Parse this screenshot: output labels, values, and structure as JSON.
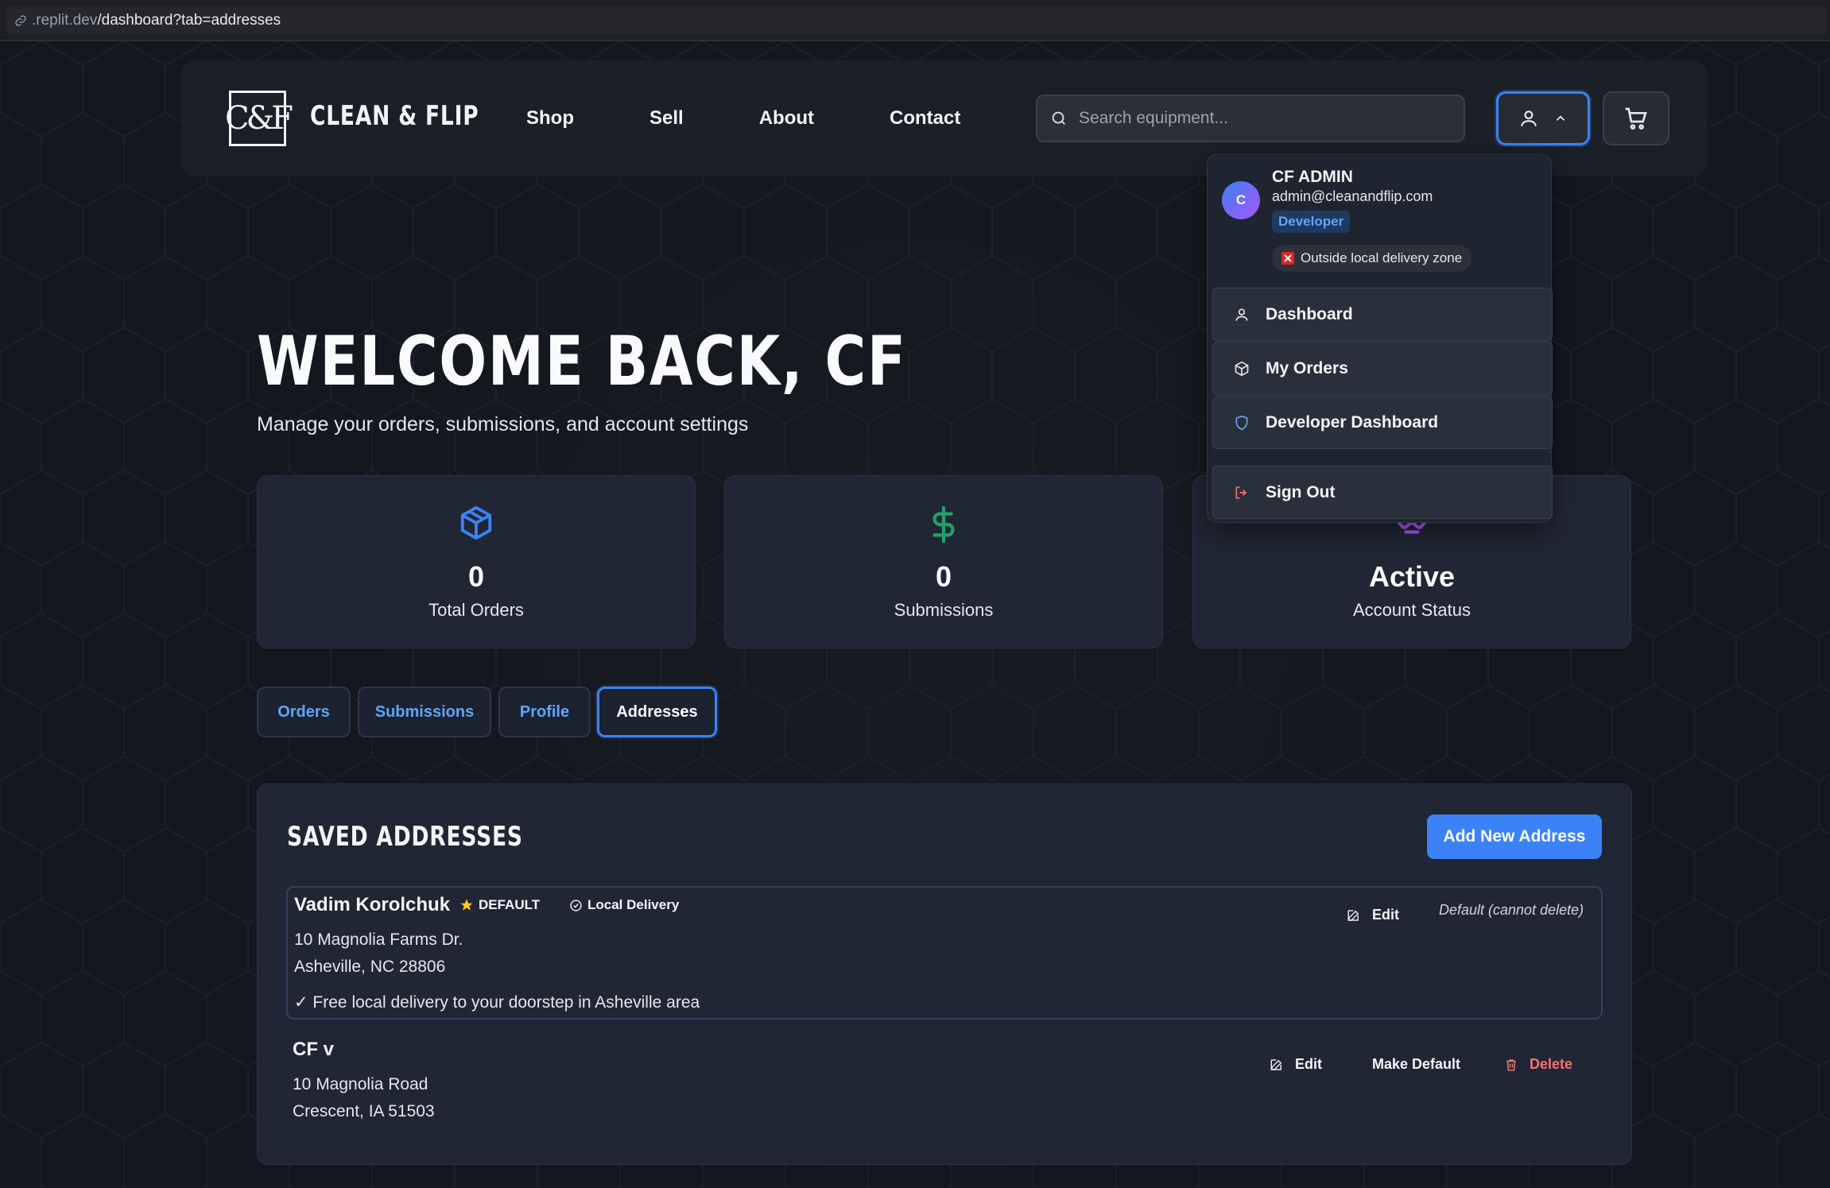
{
  "browser": {
    "url_domain": ".replit.dev",
    "url_path": "/dashboard?tab=addresses"
  },
  "header": {
    "logo_text": "C&F",
    "brand": "CLEAN & FLIP",
    "nav": [
      "Shop",
      "Sell",
      "About",
      "Contact"
    ],
    "search_placeholder": "Search equipment..."
  },
  "welcome": {
    "title": "WELCOME BACK, CF",
    "subtitle": "Manage your orders, submissions, and account settings"
  },
  "stats": [
    {
      "value": "0",
      "label": "Total Orders",
      "icon": "package-icon",
      "color": "#3b82f6"
    },
    {
      "value": "0",
      "label": "Submissions",
      "icon": "dollar-icon",
      "color": "#22a06b"
    },
    {
      "value": "Active",
      "label": "Account Status",
      "icon": "account-status-icon",
      "color": "#a855f7"
    }
  ],
  "tabs": [
    "Orders",
    "Submissions",
    "Profile",
    "Addresses"
  ],
  "active_tab": "Addresses",
  "addresses_panel": {
    "title": "SAVED ADDRESSES",
    "add_button": "Add New Address",
    "addresses": [
      {
        "name": "Vadim Korolchuk",
        "default_badge": "DEFAULT",
        "local_badge": "Local Delivery",
        "line1": "10 Magnolia Farms Dr.",
        "line2": "Asheville, NC 28806",
        "delivery_note": "✓ Free local delivery to your doorstep in Asheville area",
        "edit_label": "Edit",
        "default_note": "Default (cannot delete)"
      },
      {
        "name": "CF v",
        "line1": "10 Magnolia Road",
        "line2": "Crescent, IA 51503",
        "edit_label": "Edit",
        "make_default_label": "Make Default",
        "delete_label": "Delete"
      }
    ]
  },
  "user_menu": {
    "avatar_letter": "C",
    "name": "CF ADMIN",
    "email": "admin@cleanandflip.com",
    "role": "Developer",
    "zone_status": "Outside local delivery zone",
    "items": [
      {
        "label": "Dashboard",
        "icon": "user-icon"
      },
      {
        "label": "My Orders",
        "icon": "package-icon"
      },
      {
        "label": "Developer Dashboard",
        "icon": "shield-icon"
      },
      {
        "label": "Sign Out",
        "icon": "sign-out-icon"
      }
    ]
  },
  "colors": {
    "accent": "#3b82f6",
    "background": "#14171e",
    "card": "#202633",
    "danger": "#f87171"
  }
}
